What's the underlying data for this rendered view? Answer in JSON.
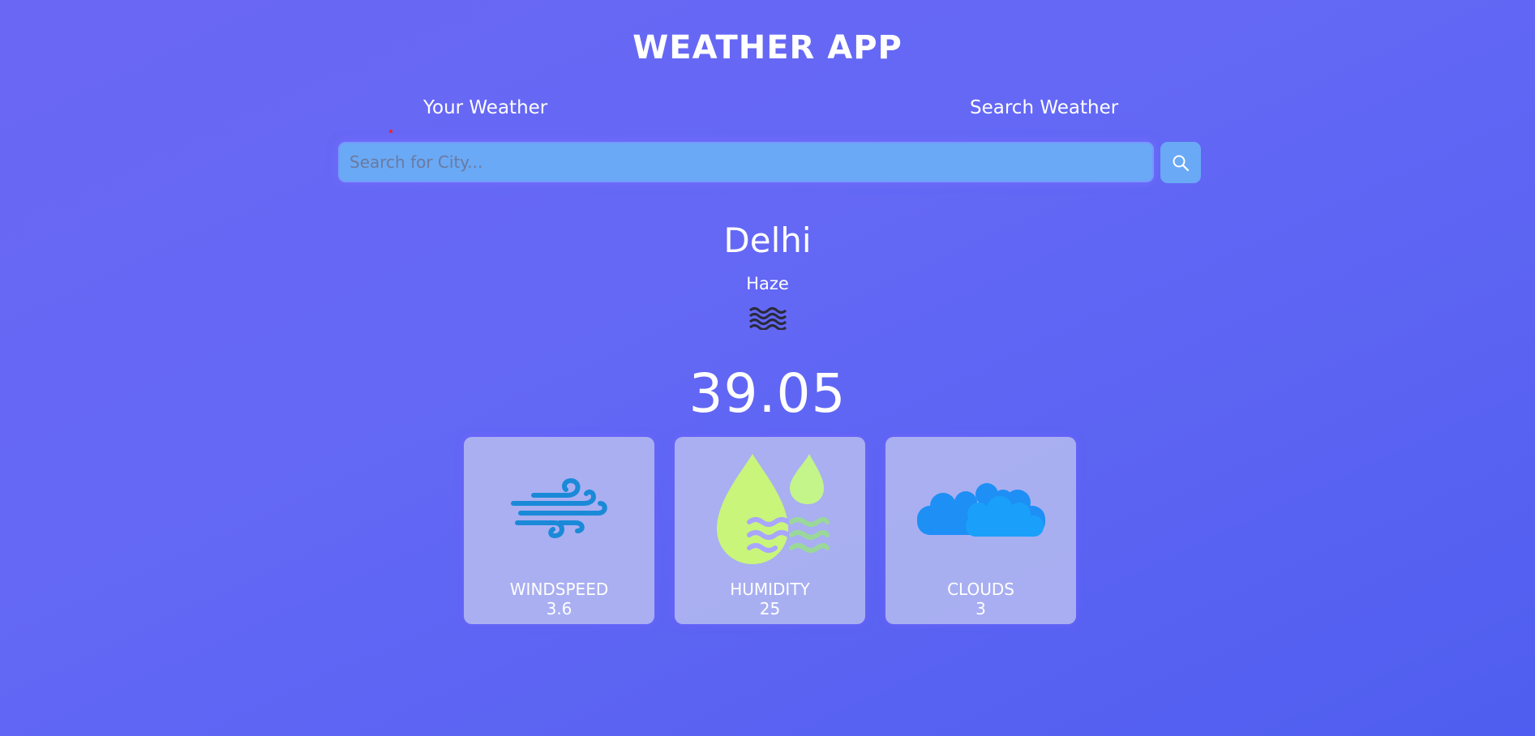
{
  "app": {
    "title": "WEATHER APP"
  },
  "tabs": {
    "your_weather": "Your Weather",
    "search_weather": "Search Weather",
    "active": "Your Weather"
  },
  "search": {
    "placeholder": "Search for City...",
    "value": "",
    "button_icon": "search-icon"
  },
  "weather": {
    "city": "Delhi",
    "condition": "Haze",
    "condition_icon": "haze-icon",
    "temperature": "39.05"
  },
  "stats": [
    {
      "label": "WINDSPEED",
      "value": "3.6",
      "icon": "wind-icon"
    },
    {
      "label": "HUMIDITY",
      "value": "25",
      "icon": "humidity-icon"
    },
    {
      "label": "CLOUDS",
      "value": "3",
      "icon": "clouds-icon"
    }
  ],
  "colors": {
    "background_start": "#6a67f4",
    "background_end": "#4f5ef0",
    "search_bg": "#6aa9f5",
    "card_bg": "#b9bef0",
    "wind_icon": "#1a8ad8",
    "humidity_icon": "#c9f57a",
    "clouds_icon": "#1e8ff5",
    "active_indicator": "#ff2020"
  }
}
